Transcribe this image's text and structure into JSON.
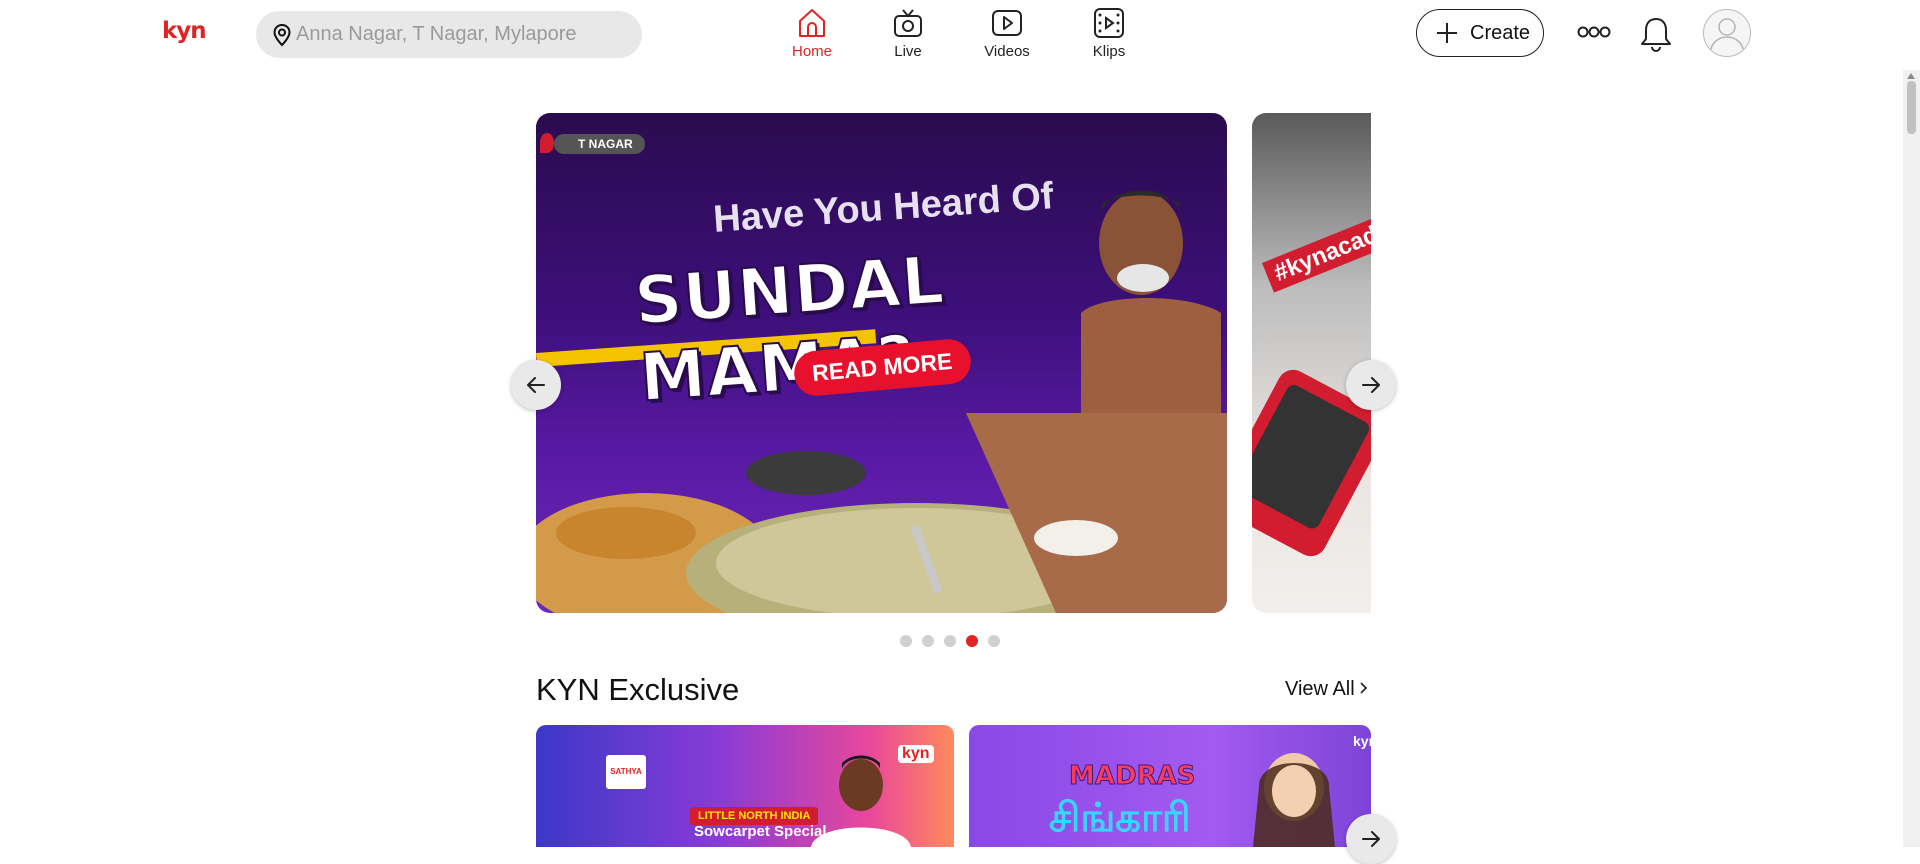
{
  "header": {
    "logo": "kyn",
    "search_placeholder": "Anna Nagar, T Nagar, Mylapore",
    "nav": [
      {
        "label": "Home",
        "icon": "home-icon",
        "active": true
      },
      {
        "label": "Live",
        "icon": "tv-icon",
        "active": false
      },
      {
        "label": "Videos",
        "icon": "play-icon",
        "active": false
      },
      {
        "label": "Klips",
        "icon": "film-icon",
        "active": false
      }
    ],
    "create_label": "Create"
  },
  "carousel": {
    "main_slide": {
      "location_tag": "T NAGAR",
      "kicker": "Have You Heard Of",
      "headline": "SUNDAL MAMA?",
      "cta": "READ MORE"
    },
    "side_slide": {
      "tag": "#kynacad"
    },
    "dot_count": 5,
    "active_dot": 4
  },
  "section": {
    "title": "KYN Exclusive",
    "view_all": "View All",
    "cards": [
      {
        "brand": "SATHYA",
        "pill": "LITTLE NORTH INDIA",
        "subtitle": "Sowcarpet Special",
        "corner_logo": "kyn"
      },
      {
        "title": "MADRAS",
        "subtitle": "சிங்காரி",
        "corner_logo": "kyn"
      }
    ]
  },
  "colors": {
    "accent": "#e02424",
    "search_bg": "#e8e8e8"
  }
}
